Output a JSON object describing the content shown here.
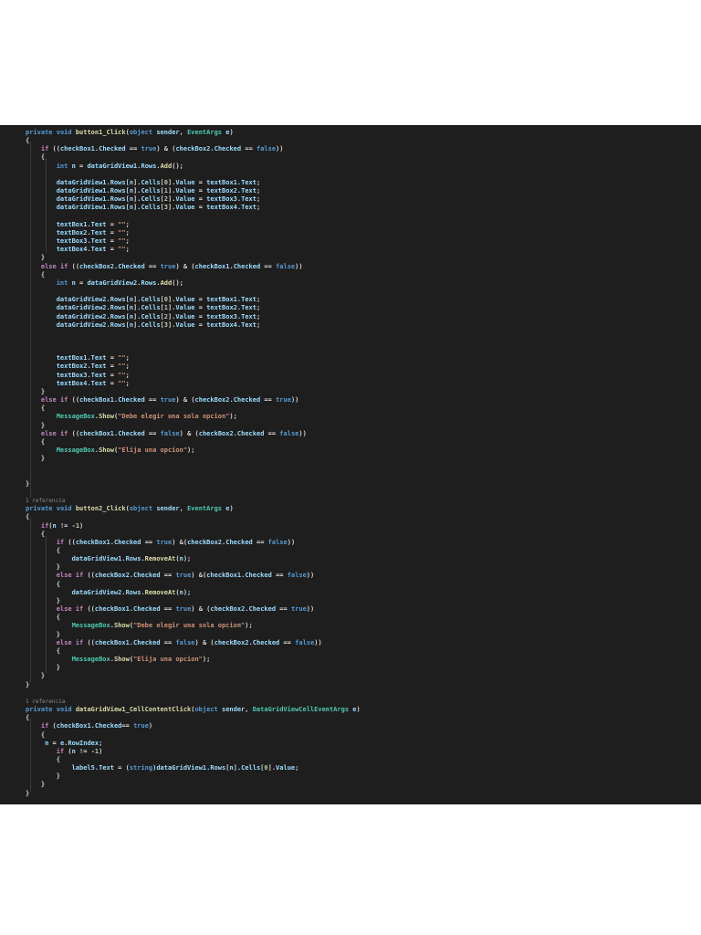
{
  "editor": {
    "background": "#1e1e1e",
    "colors": {
      "keyword": "#569cd6",
      "control": "#c586c0",
      "string": "#ce9178",
      "type": "#4ec9b0",
      "method": "#dcdcaa",
      "identifier": "#9cdcfe"
    },
    "codelens_lines": [
      44,
      68
    ],
    "lines": [
      "private void button1_Click(object sender, EventArgs e)",
      "{",
      "    if ((checkBox1.Checked == true) & (checkBox2.Checked == false))",
      "    {",
      "        int n = dataGridView1.Rows.Add();",
      "",
      "        dataGridView1.Rows[n].Cells[0].Value = textBox1.Text;",
      "        dataGridView1.Rows[n].Cells[1].Value = textBox2.Text;",
      "        dataGridView1.Rows[n].Cells[2].Value = textBox3.Text;",
      "        dataGridView1.Rows[n].Cells[3].Value = textBox4.Text;",
      "",
      "        textBox1.Text = \"\";",
      "        textBox2.Text = \"\";",
      "        textBox3.Text = \"\";",
      "        textBox4.Text = \"\";",
      "    }",
      "    else if ((checkBox2.Checked == true) & (checkBox1.Checked == false))",
      "    {",
      "        int n = dataGridView2.Rows.Add();",
      "",
      "        dataGridView2.Rows[n].Cells[0].Value = textBox1.Text;",
      "        dataGridView2.Rows[n].Cells[1].Value = textBox2.Text;",
      "        dataGridView2.Rows[n].Cells[2].Value = textBox3.Text;",
      "        dataGridView2.Rows[n].Cells[3].Value = textBox4.Text;",
      "",
      "",
      "",
      "        textBox1.Text = \"\";",
      "        textBox2.Text = \"\";",
      "        textBox3.Text = \"\";",
      "        textBox4.Text = \"\";",
      "    }",
      "    else if ((checkBox1.Checked == true) & (checkBox2.Checked == true))",
      "    {",
      "        MessageBox.Show(\"Debe elegir una sola opcion\");",
      "    }",
      "    else if ((checkBox1.Checked == false) & (checkBox2.Checked == false))",
      "    {",
      "        MessageBox.Show(\"Elija una opcion\");",
      "    }",
      "",
      "",
      "}",
      "",
      "1 referencia",
      "private void button2_Click(object sender, EventArgs e)",
      "{",
      "    if(n != -1)",
      "    {",
      "        if ((checkBox1.Checked == true) &(checkBox2.Checked == false))",
      "        {",
      "            dataGridView1.Rows.RemoveAt(n);",
      "        }",
      "        else if ((checkBox2.Checked == true) &(checkBox1.Checked == false))",
      "        {",
      "            dataGridView2.Rows.RemoveAt(n);",
      "        }",
      "        else if ((checkBox1.Checked == true) & (checkBox2.Checked == true))",
      "        {",
      "            MessageBox.Show(\"Debe elegir una sola opcion\");",
      "        }",
      "        else if ((checkBox1.Checked == false) & (checkBox2.Checked == false))",
      "        {",
      "            MessageBox.Show(\"Elija una opcion\");",
      "        }",
      "    }",
      "}",
      "",
      "1 referencia",
      "private void dataGridView1_CellContentClick(object sender, DataGridViewCellEventArgs e)",
      "{",
      "    if (checkBox1.Checked== true)",
      "    {",
      "     n = e.RowIndex;",
      "        if (n != -1)",
      "        {",
      "            label5.Text = (string)dataGridView1.Rows[n].Cells[0].Value;",
      "        }",
      "    }",
      "}"
    ]
  }
}
